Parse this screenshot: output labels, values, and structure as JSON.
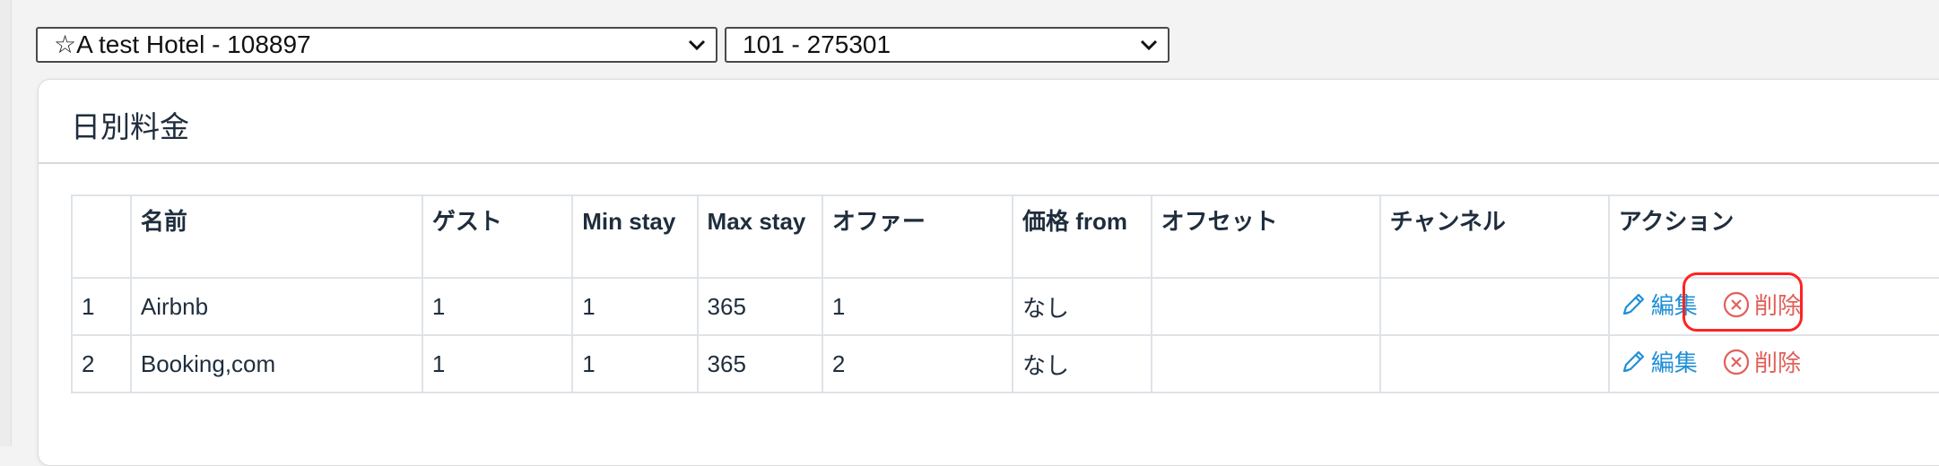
{
  "filters": {
    "hotel": "☆A test Hotel - 108897",
    "room": "101 - 275301"
  },
  "card": {
    "title": "日別料金"
  },
  "table": {
    "headers": [
      "",
      "名前",
      "ゲスト",
      "Min stay",
      "Max stay",
      "オファー",
      "価格 from",
      "オフセット",
      "チャンネル",
      "アクション"
    ],
    "rows": [
      {
        "num": "1",
        "name": "Airbnb",
        "guests": "1",
        "min_stay": "1",
        "max_stay": "365",
        "offer": "1",
        "price_from": "なし",
        "offset": "",
        "channel": "",
        "edit_label": "編集",
        "delete_label": "削除"
      },
      {
        "num": "2",
        "name": "Booking,com",
        "guests": "1",
        "min_stay": "1",
        "max_stay": "365",
        "offer": "2",
        "price_from": "なし",
        "offset": "",
        "channel": "",
        "edit_label": "編集",
        "delete_label": "削除"
      }
    ]
  },
  "colors": {
    "edit": "#1f8fd6",
    "delete": "#e0605a",
    "highlight": "#ff2222"
  }
}
